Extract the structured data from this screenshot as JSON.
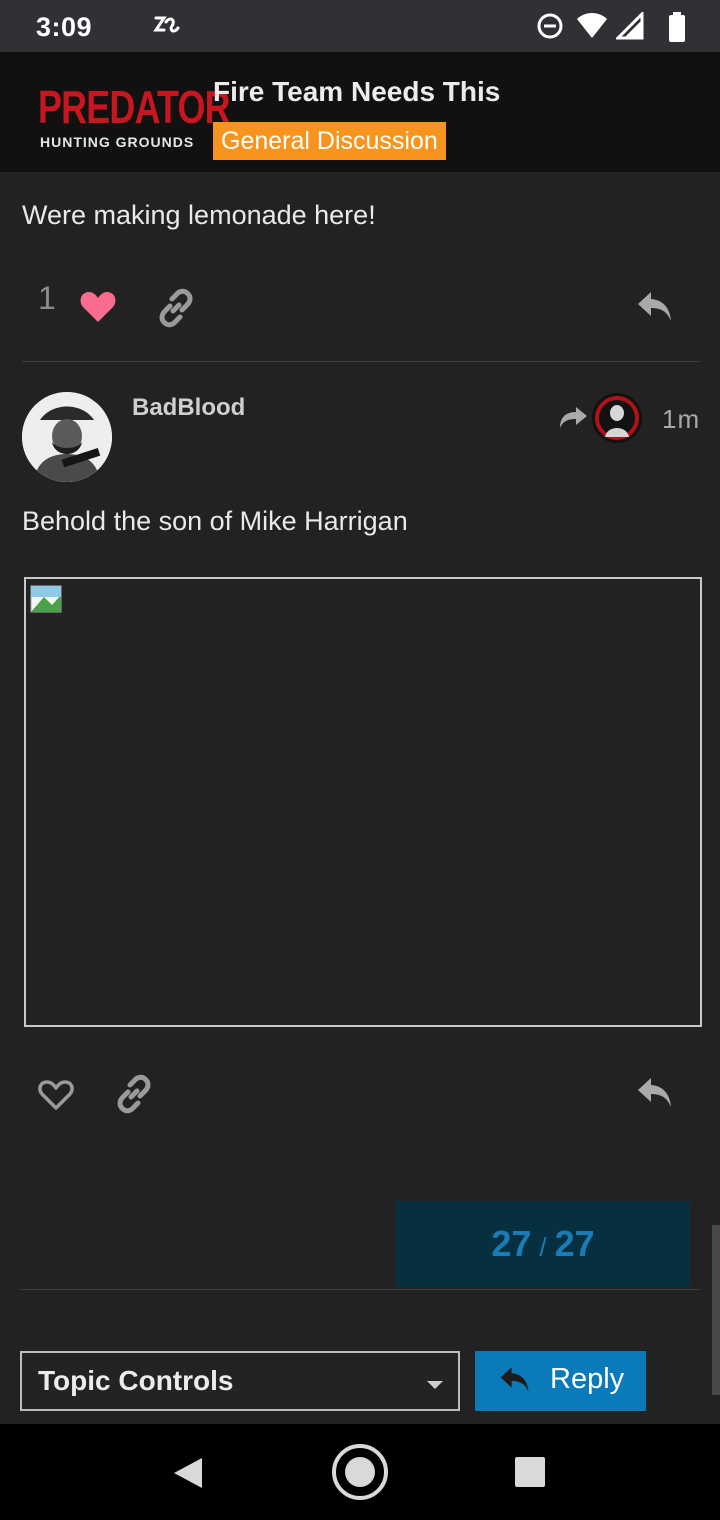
{
  "status_bar": {
    "time": "3:09"
  },
  "header": {
    "logo_main": "PREDATOR",
    "logo_sub": "HUNTING GROUNDS",
    "topic_title": "Fire Team Needs This",
    "category": "General Discussion",
    "category_color": "#f7941d"
  },
  "previous_post": {
    "text": "Were making lemonade here!",
    "like_count": "1",
    "like_color": "#fa6c8d"
  },
  "post": {
    "username": "BadBlood",
    "age": "1m",
    "text": "Behold the son of Mike Harrigan"
  },
  "timeline": {
    "current": "27",
    "separator": "/",
    "total": "27"
  },
  "footer": {
    "topic_controls_label": "Topic Controls",
    "reply_label": "Reply",
    "reply_color": "#0a7ab9"
  },
  "icons": [
    "heart-icon",
    "link-icon",
    "reply-icon",
    "share-arrow-icon",
    "chevron-down-icon",
    "back-icon",
    "home-icon",
    "recents-icon"
  ]
}
